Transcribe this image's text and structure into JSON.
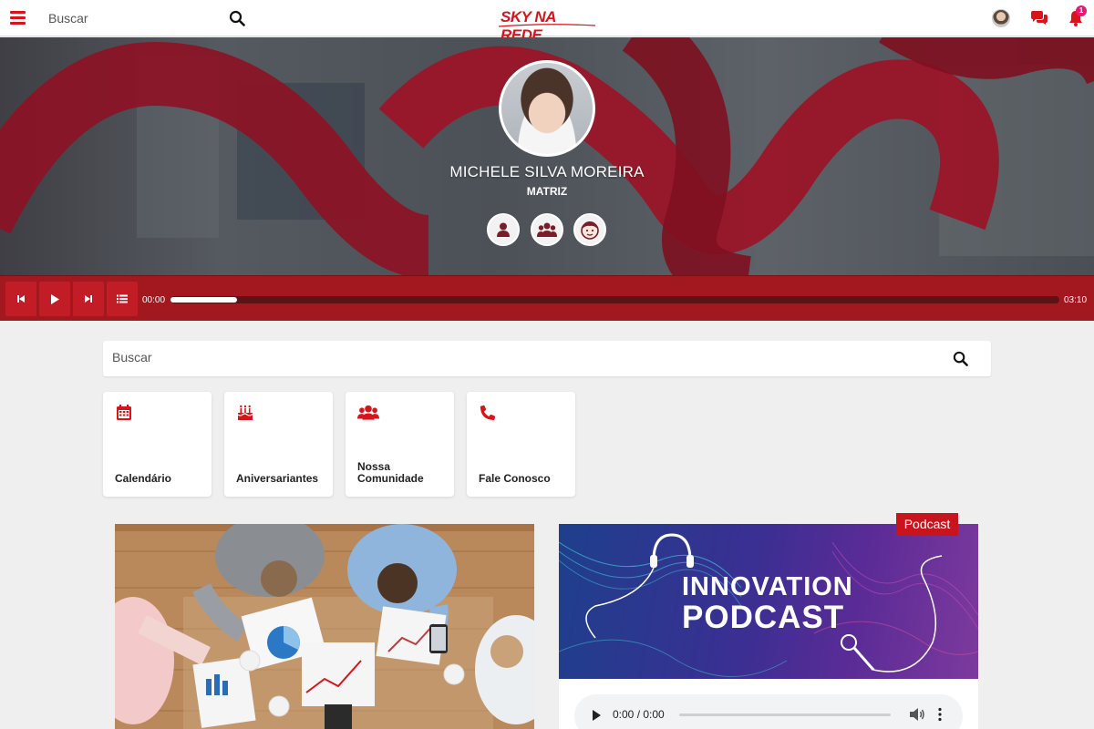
{
  "topbar": {
    "search_placeholder": "Buscar",
    "logo_text": "SKY NA REDE",
    "notification_count": "1"
  },
  "profile": {
    "name": "MICHELE SILVA MOREIRA",
    "subtitle": "MATRIZ",
    "buttons": [
      "user-icon",
      "users-group-icon",
      "kid-face-icon"
    ]
  },
  "player": {
    "current_time": "00:00",
    "total_time": "03:10",
    "progress": 0.075
  },
  "main_search": {
    "placeholder": "Buscar"
  },
  "shortcuts": [
    {
      "label": "Calendário",
      "icon": "calendar-icon"
    },
    {
      "label": "Aniversariantes",
      "icon": "birthday-cake-icon"
    },
    {
      "label": "Nossa Comunidade",
      "icon": "community-icon"
    },
    {
      "label": "Fale Conosco",
      "icon": "phone-icon"
    }
  ],
  "podcast": {
    "tag": "Podcast",
    "banner_line1": "INNOVATION",
    "banner_line2": "PODCAST",
    "audio_time": "0:00 / 0:00"
  },
  "colors": {
    "brand_red": "#d7141a",
    "player_red": "#a3181f",
    "badge_pink": "#e8176f"
  }
}
